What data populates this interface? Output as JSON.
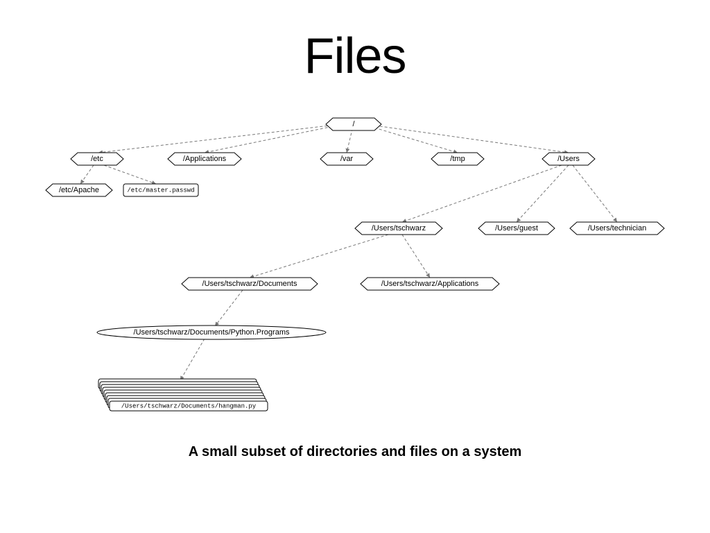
{
  "title": "Files",
  "caption": "A small subset of directories and files on a system",
  "nodes": {
    "root": "/",
    "etc": "/etc",
    "applications": "/Applications",
    "var": "/var",
    "tmp": "/tmp",
    "users": "/Users",
    "etc_apache": "/etc/Apache",
    "etc_master_passwd": "/etc/master.passwd",
    "users_tschwarz": "/Users/tschwarz",
    "users_guest": "/Users/guest",
    "users_technician": "/Users/technician",
    "users_tschwarz_documents": "/Users/tschwarz/Documents",
    "users_tschwarz_applications": "/Users/tschwarz/Applications",
    "users_tschwarz_documents_pythonprograms": "/Users/tschwarz/Documents/Python.Programs",
    "file_hangman": "/Users/tschwarz/Documents/hangman.py"
  },
  "tree": {
    "/": [
      "/etc",
      "/Applications",
      "/var",
      "/tmp",
      "/Users"
    ],
    "/etc": [
      "/etc/Apache",
      "/etc/master.passwd"
    ],
    "/Users": [
      "/Users/tschwarz",
      "/Users/guest",
      "/Users/technician"
    ],
    "/Users/tschwarz": [
      "/Users/tschwarz/Documents",
      "/Users/tschwarz/Applications"
    ],
    "/Users/tschwarz/Documents": [
      "/Users/tschwarz/Documents/Python.Programs"
    ],
    "/Users/tschwarz/Documents/Python.Programs": [
      "/Users/tschwarz/Documents/hangman.py"
    ]
  }
}
